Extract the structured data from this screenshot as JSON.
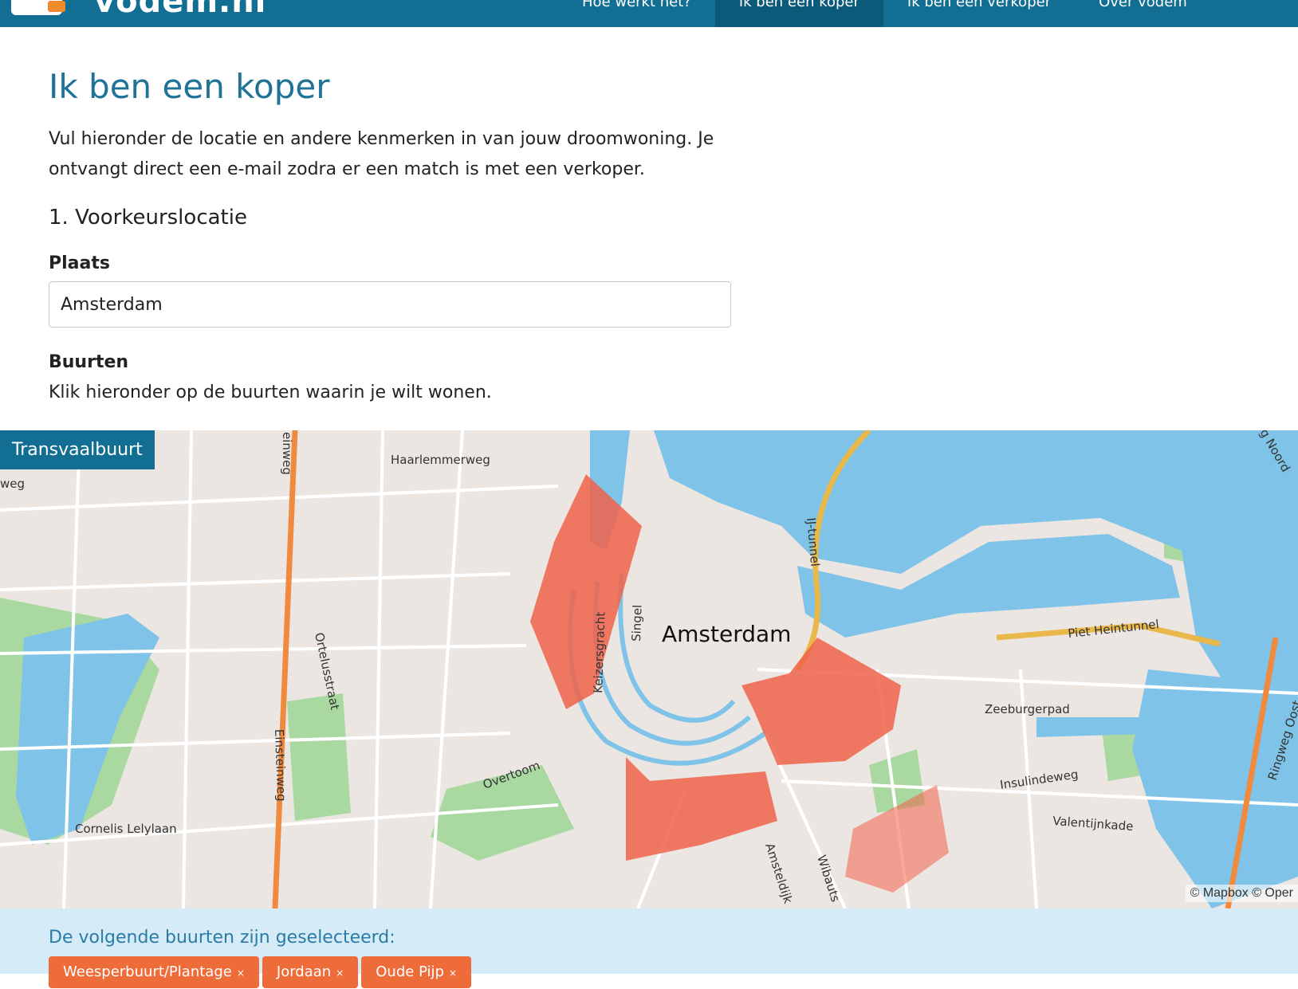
{
  "header": {
    "logo_text": "vodem.nl",
    "nav": [
      {
        "label": "Hoe werkt het?"
      },
      {
        "label": "Ik ben een koper"
      },
      {
        "label": "Ik ben een verkoper"
      },
      {
        "label": "Over vodem"
      }
    ]
  },
  "page": {
    "title": "Ik ben een koper",
    "intro": "Vul hieronder de locatie en andere kenmerken in van jouw droomwoning. Je ontvangt direct een e-mail zodra er een match is met een verkoper.",
    "section": "1. Voorkeurslocatie",
    "plaats_label": "Plaats",
    "plaats_value": "Amsterdam",
    "buurten_label": "Buurten",
    "buurten_helper": "Klik hieronder op de buurten waarin je wilt wonen."
  },
  "map": {
    "hover_label": "Transvaalbuurt",
    "city_label": "Amsterdam",
    "street_labels": [
      "Haarlemmerweg",
      "einweg",
      "weg",
      "IJ-tunnel",
      "Piet Heintunnel",
      "Ortelusstraat",
      "Keizersgracht",
      "Singel",
      "Zeeburgerpad",
      "Einsteinweg",
      "Overtoom",
      "Insulindeweg",
      "Cornelis Lelylaan",
      "Valentijnkade",
      "Amsteldijk",
      "Wibauts",
      "Ringweg Oost",
      "g Noord"
    ],
    "attribution": "© Mapbox © Oper",
    "colors": {
      "water": "#7fc4e8",
      "land": "#ece6e2",
      "park": "#a9d9a0",
      "selected": "#f0614a",
      "highway": "#ef8a3f",
      "tunnel": "#e9b84a"
    }
  },
  "selection": {
    "title": "De volgende buurten zijn geselecteerd:",
    "tags": [
      {
        "label": "Weesperbuurt/Plantage"
      },
      {
        "label": "Jordaan"
      },
      {
        "label": "Oude Pijp"
      }
    ],
    "remove_icon": "×"
  }
}
